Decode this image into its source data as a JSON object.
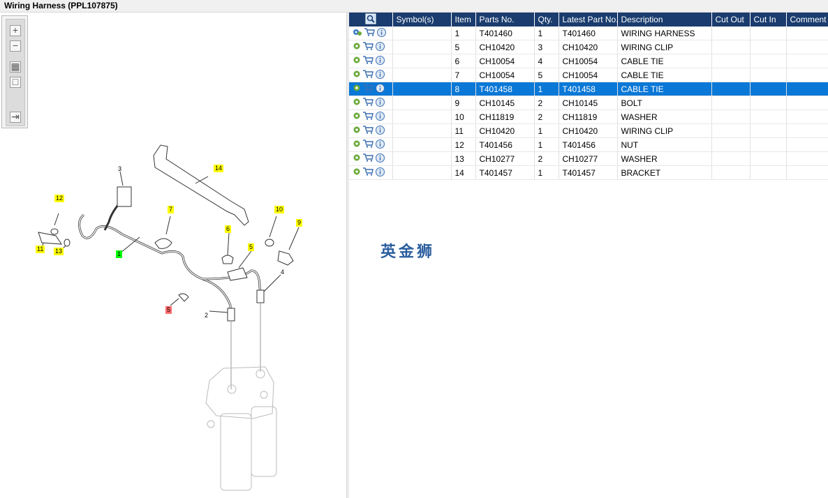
{
  "window": {
    "title": "Wiring Harness (PPL107875)"
  },
  "toolbar": {
    "buttons": [
      {
        "icon": "zoom-in-icon"
      },
      {
        "icon": "zoom-out-icon"
      },
      {
        "icon": "fit-all-icon"
      },
      {
        "icon": "reset-view-icon"
      },
      {
        "icon": "export-icon"
      }
    ]
  },
  "diagram": {
    "callouts": [
      "3",
      "14",
      "12",
      "7",
      "10",
      "9",
      "11",
      "13",
      "1",
      "6",
      "5",
      "4",
      "5",
      "2"
    ]
  },
  "grid": {
    "columns": [
      "Symbol(s)",
      "Item",
      "Parts No.",
      "Qty.",
      "Latest Part No.",
      "Description",
      "Cut Out",
      "Cut In",
      "Comment"
    ],
    "rows": [
      {
        "item": "1",
        "part": "T401460",
        "qty": "1",
        "latest": "T401460",
        "desc": "WIRING HARNESS",
        "selected": false
      },
      {
        "item": "5",
        "part": "CH10420",
        "qty": "3",
        "latest": "CH10420",
        "desc": "WIRING CLIP",
        "selected": false
      },
      {
        "item": "6",
        "part": "CH10054",
        "qty": "4",
        "latest": "CH10054",
        "desc": "CABLE TIE",
        "selected": false
      },
      {
        "item": "7",
        "part": "CH10054",
        "qty": "5",
        "latest": "CH10054",
        "desc": "CABLE TIE",
        "selected": false
      },
      {
        "item": "8",
        "part": "T401458",
        "qty": "1",
        "latest": "T401458",
        "desc": "CABLE TIE",
        "selected": true
      },
      {
        "item": "9",
        "part": "CH10145",
        "qty": "2",
        "latest": "CH10145",
        "desc": "BOLT",
        "selected": false
      },
      {
        "item": "10",
        "part": "CH11819",
        "qty": "2",
        "latest": "CH11819",
        "desc": "WASHER",
        "selected": false
      },
      {
        "item": "11",
        "part": "CH10420",
        "qty": "1",
        "latest": "CH10420",
        "desc": "WIRING CLIP",
        "selected": false
      },
      {
        "item": "12",
        "part": "T401456",
        "qty": "1",
        "latest": "T401456",
        "desc": "NUT",
        "selected": false
      },
      {
        "item": "13",
        "part": "CH10277",
        "qty": "2",
        "latest": "CH10277",
        "desc": "WASHER",
        "selected": false
      },
      {
        "item": "14",
        "part": "T401457",
        "qty": "1",
        "latest": "T401457",
        "desc": "BRACKET",
        "selected": false
      }
    ]
  },
  "watermark": "英金狮",
  "colors": {
    "header": "#1a3c6e",
    "selected_row": "#0a78d7",
    "callout": "#ffff00"
  }
}
